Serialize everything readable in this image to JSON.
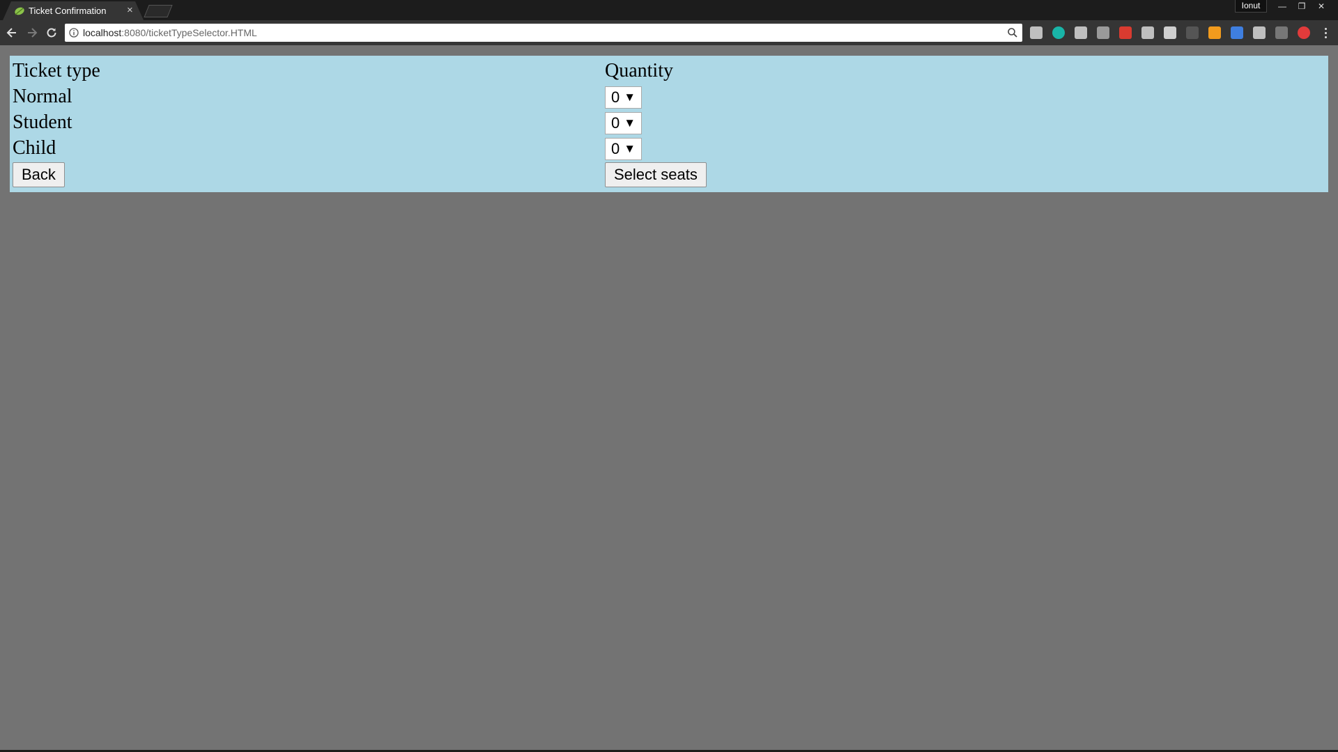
{
  "browser": {
    "tab_title": "Ticket Confirmation",
    "tab_close": "×",
    "profile_name": "Ionut",
    "window_controls": {
      "minimize": "—",
      "restore": "❐",
      "close": "✕"
    },
    "url_host": "localhost",
    "url_path": ":8080/ticketTypeSelector.HTML"
  },
  "extensions": [
    {
      "name": "ext-icon",
      "color": "#bfbfbf"
    },
    {
      "name": "ext-icon",
      "color": "#19b5a8"
    },
    {
      "name": "ext-icon",
      "color": "#bfbfbf"
    },
    {
      "name": "ext-icon",
      "color": "#9a9a9a"
    },
    {
      "name": "ext-icon",
      "color": "#d93b30"
    },
    {
      "name": "ext-icon",
      "color": "#bfbfbf"
    },
    {
      "name": "ext-icon",
      "color": "#cfcfcf"
    },
    {
      "name": "ext-icon",
      "color": "#555555"
    },
    {
      "name": "ext-icon",
      "color": "#f29b1d"
    },
    {
      "name": "ext-icon",
      "color": "#3f7fe0"
    },
    {
      "name": "ext-icon",
      "color": "#bfbfbf"
    },
    {
      "name": "ext-icon",
      "color": "#777777"
    },
    {
      "name": "ext-icon",
      "color": "#e23b3b"
    }
  ],
  "table": {
    "header_type": "Ticket type",
    "header_quantity": "Quantity",
    "rows": [
      {
        "type": "Normal",
        "quantity": "0"
      },
      {
        "type": "Student",
        "quantity": "0"
      },
      {
        "type": "Child",
        "quantity": "0"
      }
    ]
  },
  "actions": {
    "back_label": "Back",
    "select_seats_label": "Select seats"
  },
  "colors": {
    "page_background": "#737373",
    "panel_background": "#add8e6"
  }
}
